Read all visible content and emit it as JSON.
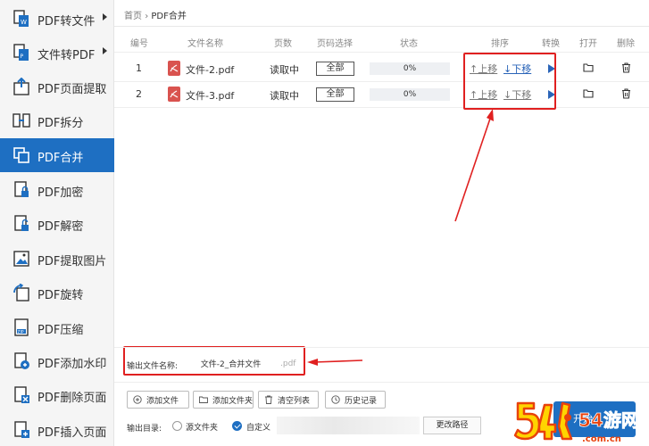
{
  "sidebar": {
    "items": [
      {
        "label": "PDF转文件",
        "has_arrow": true
      },
      {
        "label": "文件转PDF",
        "has_arrow": true
      },
      {
        "label": "PDF页面提取"
      },
      {
        "label": "PDF拆分"
      },
      {
        "label": "PDF合并",
        "active": true
      },
      {
        "label": "PDF加密"
      },
      {
        "label": "PDF解密"
      },
      {
        "label": "PDF提取图片"
      },
      {
        "label": "PDF旋转"
      },
      {
        "label": "PDF压缩"
      },
      {
        "label": "PDF添加水印"
      },
      {
        "label": "PDF删除页面"
      },
      {
        "label": "PDF插入页面"
      }
    ]
  },
  "breadcrumb": {
    "home": "首页",
    "separator": "›",
    "current": "PDF合并"
  },
  "table": {
    "headers": [
      "编号",
      "文件名称",
      "页数",
      "页码选择",
      "状态",
      "排序",
      "转换",
      "打开",
      "删除"
    ],
    "rows": [
      {
        "index": "1",
        "file_name": "文件-2.pdf",
        "pages": "读取中",
        "range": "全部",
        "progress_text": "0%",
        "progress": 0,
        "move_up": "↑上移",
        "move_down": "↓下移"
      },
      {
        "index": "2",
        "file_name": "文件-3.pdf",
        "pages": "读取中",
        "range": "全部",
        "progress_text": "0%",
        "progress": 0,
        "move_up": "↑上移",
        "move_down": "↓下移"
      }
    ]
  },
  "output": {
    "label": "输出文件名称:",
    "value": "文件-2_合并文件",
    "extension": ".pdf"
  },
  "toolbar": {
    "add_file": "添加文件",
    "add_folder": "添加文件夹",
    "clear_list": "清空列表",
    "history": "历史记录"
  },
  "directory": {
    "label": "输出目录:",
    "option_source": "源文件夹",
    "option_custom": "自定义",
    "path": "",
    "change_path": "更改路径"
  },
  "start_button": "开始",
  "watermark": {
    "text": "54游网",
    "domain": ".com.cn"
  },
  "colors": {
    "accent": "#1e6fc2",
    "highlight": "#e02020",
    "pdf_icon": "#d9534f",
    "link": "#2a64b8"
  }
}
